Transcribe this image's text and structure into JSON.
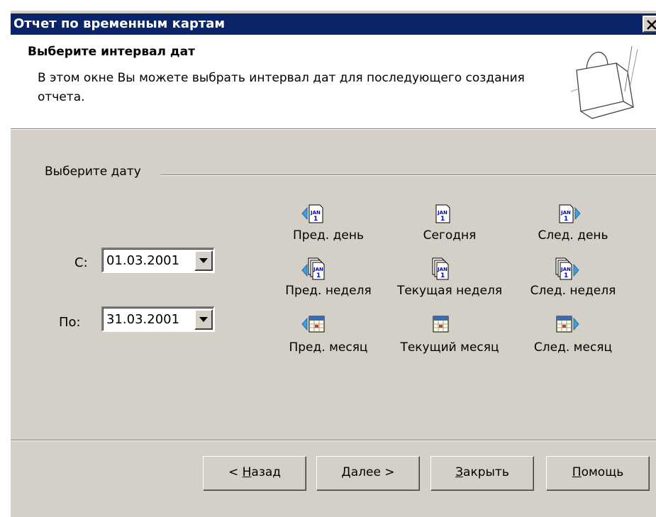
{
  "window": {
    "title": "Отчет по временным картам"
  },
  "header": {
    "title": "Выберите интервал дат",
    "description": "В этом окне Вы можете выбрать интервал дат для последующего создания отчета.",
    "icon": "wizard-bag-icon"
  },
  "group": {
    "label": "Выберите дату"
  },
  "date_from": {
    "label": "С:",
    "value": "01.03.2001"
  },
  "date_to": {
    "label": "По:",
    "value": "31.03.2001"
  },
  "nav": {
    "prev_day": "Пред. день",
    "today": "Сегодня",
    "next_day": "След. день",
    "prev_week": "Пред. неделя",
    "current_week": "Текущая неделя",
    "next_week": "След. неделя",
    "prev_month": "Пред. месяц",
    "current_month": "Текущий месяц",
    "next_month": "След. месяц",
    "calendar_page_text": "JAN",
    "calendar_page_num": "1"
  },
  "buttons": {
    "back_prefix": "< ",
    "back_accel": "Н",
    "back_rest": "азад",
    "next_accel": "Д",
    "next_rest": "алее >",
    "close_accel": "З",
    "close_rest": "акрыть",
    "help_accel": "П",
    "help_rest": "омощь"
  },
  "colors": {
    "title_bar": "#0a246a",
    "dialog_face": "#d4d0c8",
    "arrow": "#3aa0e0",
    "calendar_text": "#0000c0",
    "month_icon": "#3a6ab0"
  }
}
